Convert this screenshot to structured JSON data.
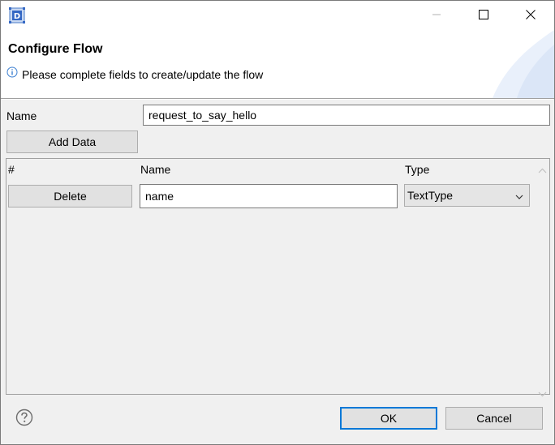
{
  "window": {
    "app_icon": "eclipse-dialog-icon",
    "controls": [
      "minimize-icon",
      "maximize-icon",
      "close-icon"
    ]
  },
  "header": {
    "title": "Configure Flow",
    "message": "Please complete fields to create/update the flow",
    "message_icon": "info-icon"
  },
  "form": {
    "name_label": "Name",
    "name_value": "request_to_say_hello",
    "add_data_label": "Add Data"
  },
  "table": {
    "columns": [
      "#",
      "Name",
      "Type"
    ],
    "rows": [
      {
        "action_label": "Delete",
        "name": "name",
        "type": "TextType"
      }
    ]
  },
  "footer": {
    "help_icon": "help-icon",
    "ok_label": "OK",
    "cancel_label": "Cancel"
  },
  "colors": {
    "dialog_background": "#f0f0f0",
    "header_background": "#ffffff",
    "default_button_border": "#0078d7"
  }
}
